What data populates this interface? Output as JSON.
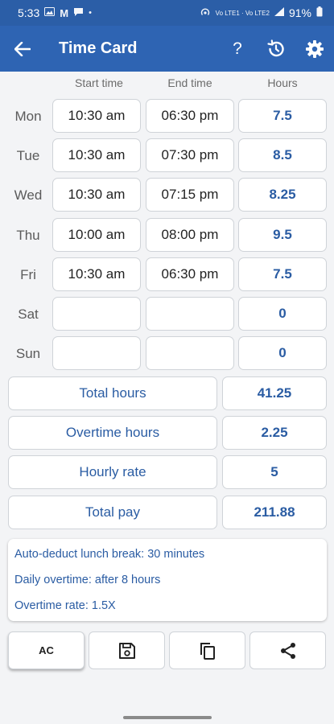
{
  "status_bar": {
    "time": "5:33",
    "battery": "91%",
    "network": "Vo LTE1 · Vo LTE2"
  },
  "app_bar": {
    "title": "Time Card",
    "back_icon": "arrow-left-icon",
    "help_label": "?",
    "history_icon": "history-icon",
    "settings_icon": "gear-icon"
  },
  "columns": {
    "start": "Start time",
    "end": "End time",
    "hours": "Hours"
  },
  "days": [
    {
      "day": "Mon",
      "start": "10:30 am",
      "end": "06:30 pm",
      "hours": "7.5"
    },
    {
      "day": "Tue",
      "start": "10:30 am",
      "end": "07:30 pm",
      "hours": "8.5"
    },
    {
      "day": "Wed",
      "start": "10:30 am",
      "end": "07:15 pm",
      "hours": "8.25"
    },
    {
      "day": "Thu",
      "start": "10:00 am",
      "end": "08:00 pm",
      "hours": "9.5"
    },
    {
      "day": "Fri",
      "start": "10:30 am",
      "end": "06:30 pm",
      "hours": "7.5"
    },
    {
      "day": "Sat",
      "start": "",
      "end": "",
      "hours": "0"
    },
    {
      "day": "Sun",
      "start": "",
      "end": "",
      "hours": "0"
    }
  ],
  "summary": [
    {
      "label": "Total hours",
      "value": "41.25"
    },
    {
      "label": "Overtime hours",
      "value": "2.25"
    },
    {
      "label": "Hourly rate",
      "value": "5"
    },
    {
      "label": "Total pay",
      "value": "211.88"
    }
  ],
  "settings": {
    "lunch": "Auto-deduct lunch break: 30 minutes",
    "daily_overtime": "Daily overtime: after 8 hours",
    "overtime_rate": "Overtime rate: 1.5X"
  },
  "bottom_bar": {
    "ac_label": "AC",
    "save_icon": "save-icon",
    "copy_icon": "copy-icon",
    "share_icon": "share-icon"
  },
  "colors": {
    "app_bar": "#2e64b3",
    "status_bar": "#2b5ea7",
    "accent_text": "#2a5ca3",
    "background": "#f3f4f6"
  }
}
